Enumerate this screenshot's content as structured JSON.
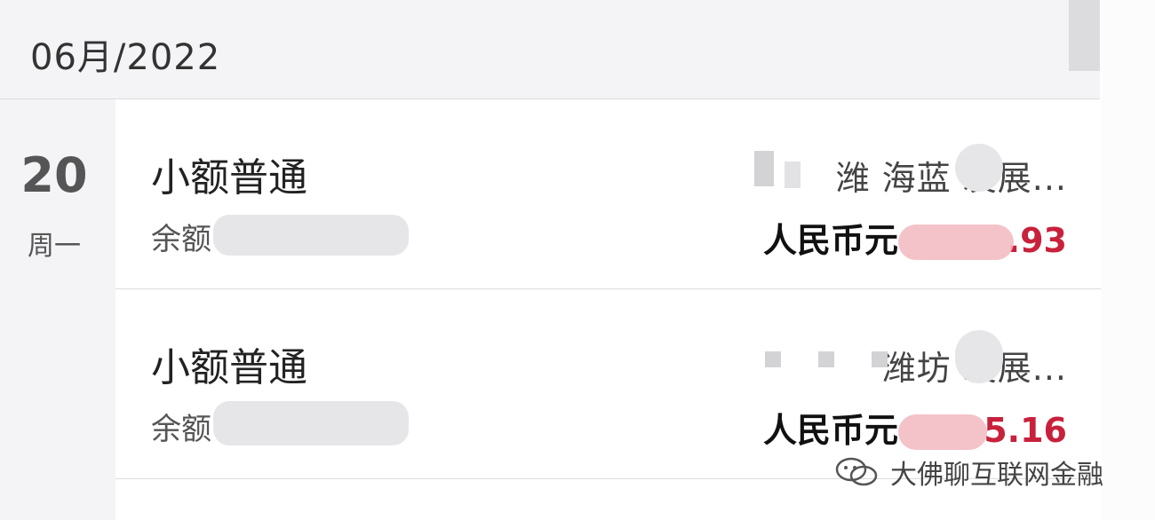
{
  "header": {
    "month": "06月/2022"
  },
  "date_group": {
    "day": "20",
    "weekday": "周一"
  },
  "transactions": [
    {
      "type": "小额普通",
      "balance_label": "余额",
      "counterparty": "潍 海蓝 发展...",
      "currency": "人民币元",
      "amount_suffix": ".93"
    },
    {
      "type": "小额普通",
      "balance_label": "余额",
      "counterparty": "潍坊 发展...",
      "currency": "人民币元",
      "amount_suffix": "5.16"
    }
  ],
  "watermark": {
    "text": "大佛聊互联网金融",
    "icon": "wechat-icon"
  },
  "colors": {
    "amount": "#c8213c",
    "background_group": "#f4f4f6"
  }
}
